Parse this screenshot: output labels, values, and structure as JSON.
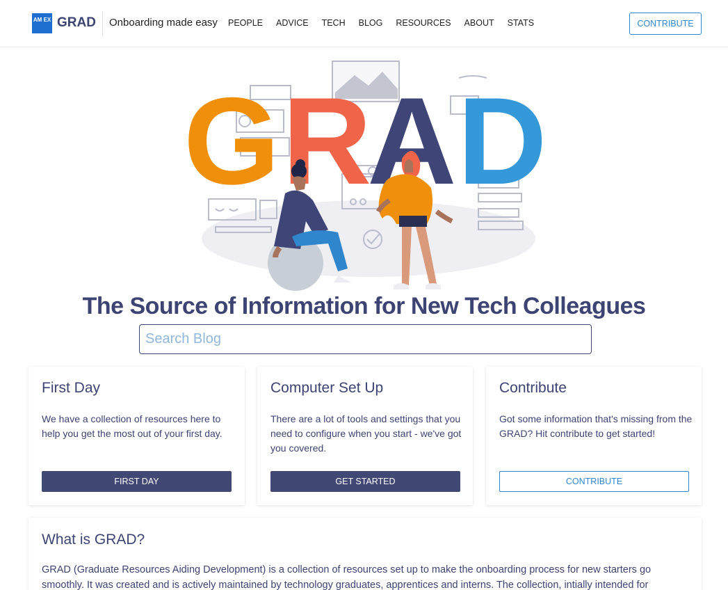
{
  "header": {
    "logo_box": "AM EX",
    "logo_text": "GRAD",
    "tagline": "Onboarding made easy",
    "nav": [
      "PEOPLE",
      "ADVICE",
      "TECH",
      "BLOG",
      "RESOURCES",
      "ABOUT",
      "STATS"
    ],
    "contribute_label": "CONTRIBUTE"
  },
  "hero": {
    "graphic_letters": [
      "G",
      "R",
      "A",
      "D"
    ],
    "title": "The Source of Information for New Tech Colleagues",
    "search_placeholder": "Search Blog"
  },
  "cards": [
    {
      "title": "First Day",
      "text": "We have a collection of resources here to help you get the most out of your first day.",
      "button": "FIRST DAY"
    },
    {
      "title": "Computer Set Up",
      "text": "There are a lot of tools and settings that you need to configure when you start - we've got you covered.",
      "button": "GET STARTED"
    },
    {
      "title": "Contribute",
      "text": "Got some information that's missing from the GRAD? Hit contribute to get started!",
      "button": "CONTRIBUTE"
    }
  ],
  "about": {
    "title": "What is GRAD?",
    "text": "GRAD (Graduate Resources Aiding Development) is a collection of resources set up to make the onboarding process for new starters go smoothly. It was created and is actively maintained by technology graduates, apprentices and interns. The collection, intially intended for"
  },
  "colors": {
    "brand_navy": "#3d4474",
    "accent_blue": "#2f86cc",
    "letter_g": "#f0900a",
    "letter_r": "#f0654a",
    "letter_a": "#3f4577",
    "letter_d": "#3598d8"
  }
}
